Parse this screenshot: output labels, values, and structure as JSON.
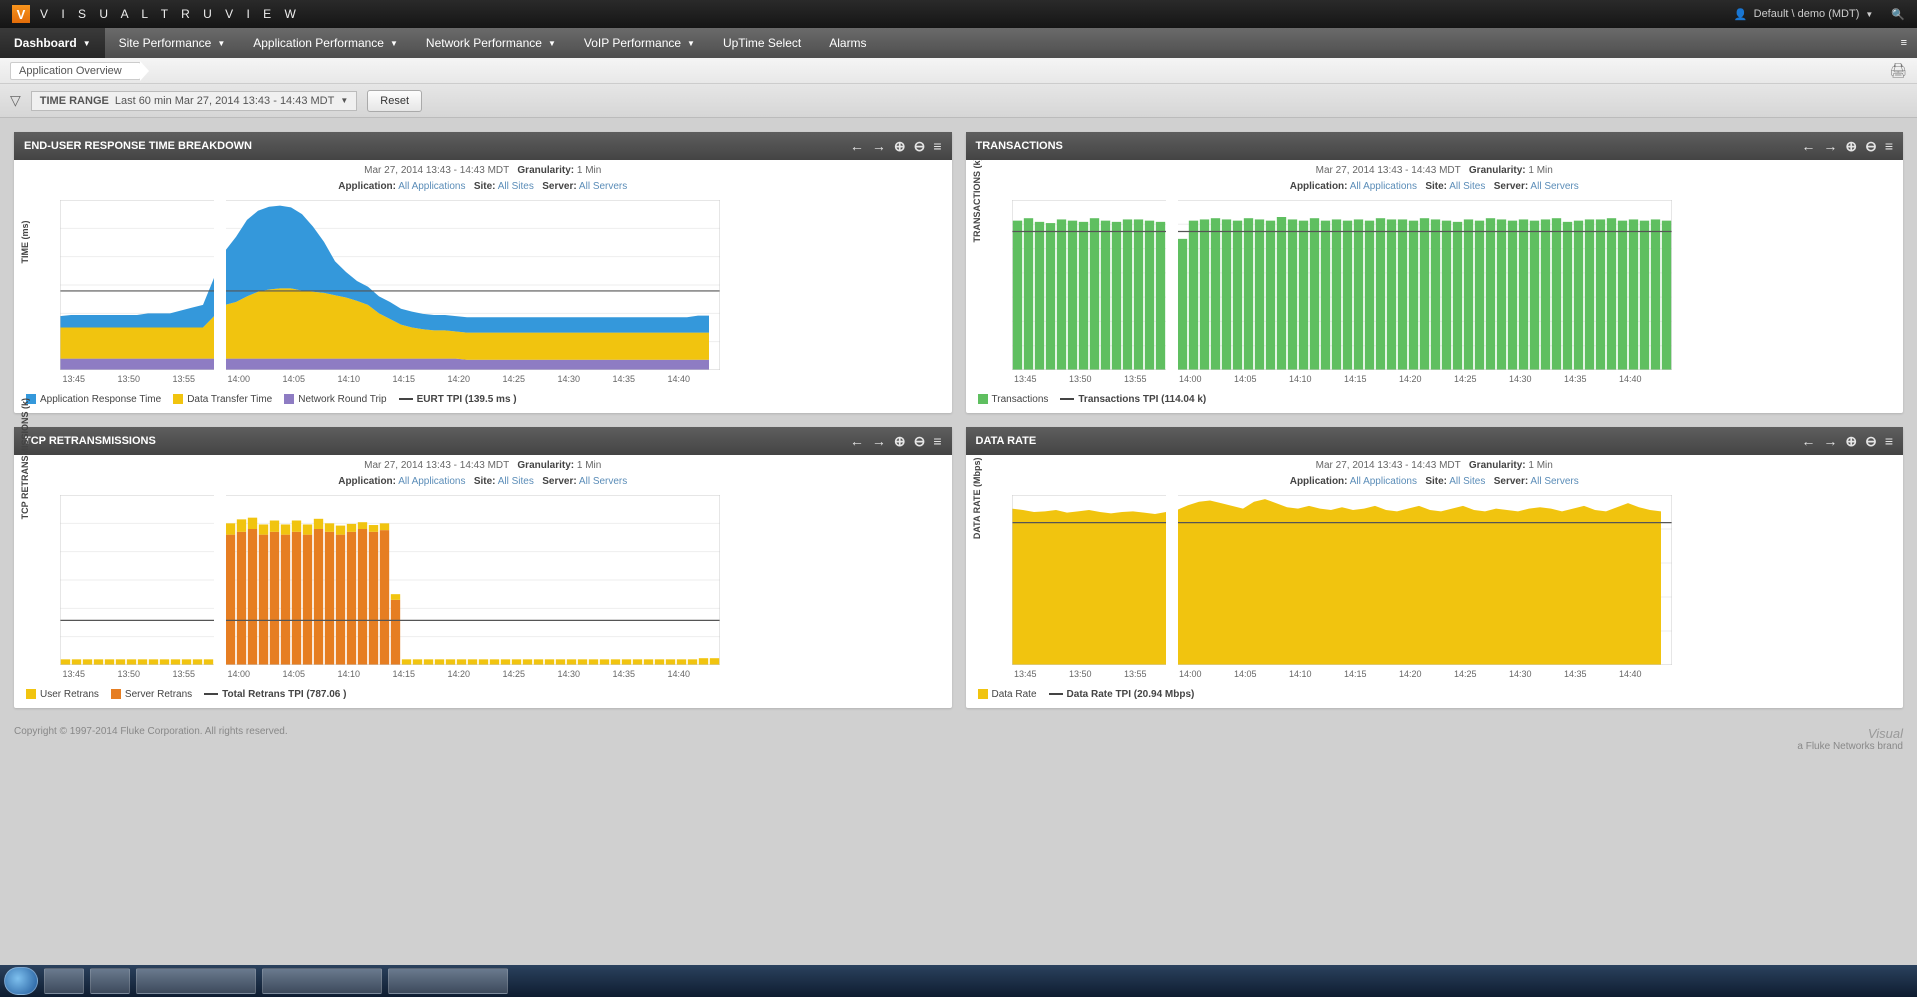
{
  "topbar": {
    "brand": "V I S U A L   T R U V I E W",
    "logo_letter": "V",
    "user_label": "Default \\ demo (MDT)"
  },
  "nav": {
    "items": [
      {
        "label": "Dashboard",
        "active": true,
        "caret": true
      },
      {
        "label": "Site Performance",
        "caret": true
      },
      {
        "label": "Application Performance",
        "caret": true
      },
      {
        "label": "Network Performance",
        "caret": true
      },
      {
        "label": "VoIP Performance",
        "caret": true
      },
      {
        "label": "UpTime Select",
        "caret": false
      },
      {
        "label": "Alarms",
        "caret": false
      }
    ]
  },
  "breadcrumb": {
    "label": "Application Overview"
  },
  "timerange": {
    "label": "TIME RANGE",
    "value": "Last 60 min Mar 27, 2014 13:43 - 14:43 MDT",
    "reset": "Reset"
  },
  "panel_common": {
    "timestamp": "Mar 27, 2014 13:43 - 14:43 MDT",
    "granularity_label": "Granularity:",
    "granularity_value": "1 Min",
    "application_label": "Application:",
    "application_value": "All Applications",
    "site_label": "Site:",
    "site_value": "All Sites",
    "server_label": "Server:",
    "server_value": "All Servers"
  },
  "panels": {
    "eurt": {
      "title": "END-USER RESPONSE TIME BREAKDOWN",
      "legend": {
        "s1": "Application Response Time",
        "s2": "Data Transfer Time",
        "s3": "Network Round Trip",
        "tpi": "EURT TPI (139.5 ms )"
      },
      "ylabel": "TIME (ms)"
    },
    "txn": {
      "title": "TRANSACTIONS",
      "legend": {
        "s1": "Transactions",
        "tpi": "Transactions TPI (114.04 k)"
      },
      "ylabel": "TRANSACTIONS (k)"
    },
    "tcp": {
      "title": "TCP RETRANSMISSIONS",
      "legend": {
        "s1": "User Retrans",
        "s2": "Server Retrans",
        "tpi": "Total Retrans TPI (787.06 )"
      },
      "ylabel": "TCP RETRANSMISSIONS (k)"
    },
    "rate": {
      "title": "DATA RATE",
      "legend": {
        "s1": "Data Rate",
        "tpi": "Data Rate TPI (20.94 Mbps)"
      },
      "ylabel": "DATA RATE (Mbps)"
    }
  },
  "footer": {
    "copyright": "Copyright © 1997-2014 Fluke Corporation. All rights reserved.",
    "visual": "Visual",
    "tagline": "a Fluke Networks brand"
  },
  "colors": {
    "blue": "#3498db",
    "yellow": "#f1c40f",
    "purple": "#8e7cc3",
    "green": "#5fbf60",
    "orange": "#e67e22",
    "lightyellow": "#f1c40f",
    "tpi": "#555"
  },
  "chart_data": [
    {
      "id": "eurt",
      "type": "area",
      "xlabel": "",
      "ylabel": "TIME (ms)",
      "ylim": [
        0,
        300
      ],
      "yticks": [
        0,
        50,
        100,
        150,
        200,
        250,
        300
      ],
      "x_categories": [
        "13:45",
        "13:50",
        "13:55",
        "14:00",
        "14:05",
        "14:10",
        "14:15",
        "14:20",
        "14:25",
        "14:30",
        "14:35",
        "14:40"
      ],
      "reference_line": 139.5,
      "gap_index": 2,
      "per_minute_points": 60,
      "series": [
        {
          "name": "Network Round Trip",
          "color": "#8e7cc3",
          "values": [
            20,
            20,
            20,
            20,
            20,
            20,
            20,
            20,
            20,
            20,
            20,
            20,
            20,
            20,
            null,
            20,
            20,
            20,
            20,
            20,
            20,
            20,
            20,
            20,
            20,
            20,
            20,
            20,
            20,
            20,
            20,
            20,
            20,
            20,
            20,
            20,
            20,
            18,
            18,
            18,
            18,
            18,
            18,
            18,
            18,
            18,
            18,
            18,
            18,
            18,
            18,
            18,
            18,
            18,
            18,
            18,
            18,
            18,
            18,
            18
          ]
        },
        {
          "name": "Data Transfer Time",
          "color": "#f1c40f",
          "values": [
            55,
            55,
            55,
            55,
            55,
            55,
            55,
            55,
            55,
            55,
            55,
            55,
            55,
            55,
            null,
            95,
            100,
            110,
            118,
            122,
            124,
            124,
            120,
            118,
            116,
            112,
            108,
            102,
            95,
            80,
            70,
            60,
            55,
            52,
            50,
            50,
            48,
            48,
            48,
            48,
            48,
            48,
            48,
            48,
            48,
            48,
            48,
            48,
            48,
            48,
            48,
            48,
            48,
            48,
            48,
            48,
            48,
            48,
            48,
            48
          ]
        },
        {
          "name": "Application Response Time",
          "color": "#3498db",
          "values": [
            20,
            22,
            22,
            22,
            22,
            22,
            22,
            22,
            25,
            25,
            25,
            30,
            35,
            40,
            null,
            95,
            115,
            135,
            143,
            146,
            146,
            143,
            135,
            115,
            90,
            60,
            45,
            35,
            32,
            30,
            30,
            28,
            28,
            27,
            27,
            27,
            27,
            27,
            27,
            27,
            27,
            27,
            27,
            27,
            27,
            27,
            27,
            27,
            27,
            27,
            27,
            27,
            27,
            27,
            27,
            27,
            27,
            27,
            30,
            30
          ]
        }
      ]
    },
    {
      "id": "txn",
      "type": "bar",
      "xlabel": "",
      "ylabel": "TRANSACTIONS (k)",
      "ylim": [
        0,
        140
      ],
      "yticks": [
        0,
        20,
        40,
        60,
        80,
        100,
        120,
        140
      ],
      "x_categories": [
        "13:45",
        "13:50",
        "13:55",
        "14:00",
        "14:05",
        "14:10",
        "14:15",
        "14:20",
        "14:25",
        "14:30",
        "14:35",
        "14:40"
      ],
      "reference_line": 114.04,
      "gap_index": 2,
      "series": [
        {
          "name": "Transactions",
          "color": "#5fbf60",
          "values": [
            123,
            125,
            122,
            121,
            124,
            123,
            122,
            125,
            123,
            122,
            124,
            124,
            123,
            122,
            null,
            108,
            123,
            124,
            125,
            124,
            123,
            125,
            124,
            123,
            126,
            124,
            123,
            125,
            123,
            124,
            123,
            124,
            123,
            125,
            124,
            124,
            123,
            125,
            124,
            123,
            122,
            124,
            123,
            125,
            124,
            123,
            124,
            123,
            124,
            125,
            122,
            123,
            124,
            124,
            125,
            123,
            124,
            123,
            124,
            123
          ]
        }
      ]
    },
    {
      "id": "tcp",
      "type": "bar",
      "xlabel": "",
      "ylabel": "TCP RETRANSMISSIONS (k)",
      "ylim": [
        0,
        3.0
      ],
      "yticks": [
        0,
        0.5,
        1.0,
        1.5,
        2.0,
        2.5,
        3.0
      ],
      "x_categories": [
        "13:45",
        "13:50",
        "13:55",
        "14:00",
        "14:05",
        "14:10",
        "14:15",
        "14:20",
        "14:25",
        "14:30",
        "14:35",
        "14:40"
      ],
      "reference_line": 0.787,
      "gap_index": 2,
      "stacked": true,
      "series": [
        {
          "name": "Server Retrans",
          "color": "#e67e22",
          "values": [
            0,
            0,
            0,
            0,
            0,
            0,
            0,
            0,
            0,
            0,
            0,
            0,
            0,
            0,
            null,
            2.3,
            2.35,
            2.4,
            2.3,
            2.35,
            2.3,
            2.35,
            2.3,
            2.4,
            2.35,
            2.3,
            2.35,
            2.4,
            2.35,
            2.38,
            1.15,
            0,
            0,
            0,
            0,
            0,
            0,
            0,
            0,
            0,
            0,
            0,
            0,
            0,
            0,
            0,
            0,
            0,
            0,
            0,
            0,
            0,
            0,
            0,
            0,
            0,
            0,
            0,
            0,
            0
          ]
        },
        {
          "name": "User Retrans",
          "color": "#f1c40f",
          "values": [
            0.1,
            0.1,
            0.1,
            0.1,
            0.1,
            0.1,
            0.1,
            0.1,
            0.1,
            0.1,
            0.1,
            0.1,
            0.1,
            0.1,
            null,
            0.2,
            0.22,
            0.2,
            0.18,
            0.2,
            0.18,
            0.2,
            0.18,
            0.18,
            0.15,
            0.16,
            0.14,
            0.12,
            0.12,
            0.12,
            0.1,
            0.1,
            0.1,
            0.1,
            0.1,
            0.1,
            0.1,
            0.1,
            0.1,
            0.1,
            0.1,
            0.1,
            0.1,
            0.1,
            0.1,
            0.1,
            0.1,
            0.1,
            0.1,
            0.1,
            0.1,
            0.1,
            0.1,
            0.1,
            0.1,
            0.1,
            0.1,
            0.1,
            0.12,
            0.12
          ]
        }
      ]
    },
    {
      "id": "rate",
      "type": "area",
      "xlabel": "",
      "ylabel": "DATA RATE (Mbps)",
      "ylim": [
        0,
        25
      ],
      "yticks": [
        0,
        5,
        10,
        15,
        20,
        25
      ],
      "x_categories": [
        "13:45",
        "13:50",
        "13:55",
        "14:00",
        "14:05",
        "14:10",
        "14:15",
        "14:20",
        "14:25",
        "14:30",
        "14:35",
        "14:40"
      ],
      "reference_line": 20.94,
      "gap_index": 2,
      "series": [
        {
          "name": "Data Rate",
          "color": "#f1c40f",
          "values": [
            23,
            22.8,
            22.5,
            22.6,
            22.8,
            22.4,
            22.6,
            22.8,
            22.5,
            22.3,
            22.5,
            22.6,
            22.4,
            22.2,
            null,
            22.8,
            23.5,
            24,
            24.2,
            23.8,
            23.4,
            23,
            24,
            24.4,
            23.8,
            23.2,
            23,
            23.4,
            23,
            22.8,
            23.2,
            22.8,
            23,
            23.4,
            22.8,
            22.6,
            23,
            23.4,
            22.8,
            22.6,
            23,
            23.4,
            22.8,
            22.6,
            23,
            22.8,
            22.6,
            23,
            23.2,
            23,
            22.6,
            23,
            23.4,
            22.8,
            22.6,
            23.2,
            23.8,
            23.2,
            22.8,
            22.6
          ]
        }
      ]
    }
  ]
}
